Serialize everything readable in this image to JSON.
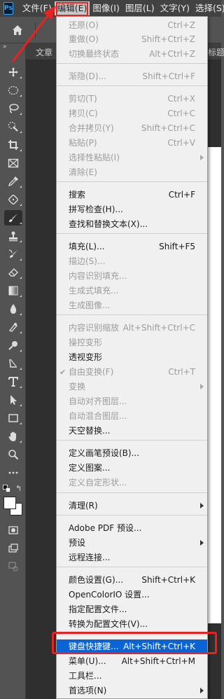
{
  "menubar": {
    "logo": "Ps",
    "items": [
      "文件(F)",
      "编辑(E)",
      "图像(I)",
      "图层(L)",
      "文字(Y)",
      "选择(S)"
    ],
    "active_index": 1
  },
  "doc_tabs": {
    "tab1": "文章",
    "tab2": "标题"
  },
  "edit_menu": {
    "items": [
      {
        "label": "还原(O)",
        "shortcut": "Ctrl+Z",
        "disabled": true
      },
      {
        "label": "重做(O)",
        "shortcut": "Shift+Ctrl+Z",
        "disabled": true
      },
      {
        "label": "切换最终状态",
        "shortcut": "Alt+Ctrl+Z",
        "disabled": true
      },
      {
        "label": "渐隐(D)...",
        "shortcut": "Shift+Ctrl+F",
        "disabled": true
      },
      {
        "label": "剪切(T)",
        "shortcut": "Ctrl+X",
        "disabled": true
      },
      {
        "label": "拷贝(C)",
        "shortcut": "Ctrl+C",
        "disabled": true
      },
      {
        "label": "合并拷贝(Y)",
        "shortcut": "Shift+Ctrl+C",
        "disabled": true
      },
      {
        "label": "粘贴(P)",
        "shortcut": "Ctrl+V",
        "disabled": true
      },
      {
        "label": "选择性粘贴(I)",
        "shortcut": "",
        "disabled": true,
        "submenu": true
      },
      {
        "label": "清除(E)",
        "shortcut": "",
        "disabled": true
      },
      {
        "label": "搜索",
        "shortcut": "Ctrl+F",
        "disabled": false
      },
      {
        "label": "拼写检查(H)...",
        "shortcut": "",
        "disabled": false
      },
      {
        "label": "查找和替换文本(X)...",
        "shortcut": "",
        "disabled": false
      },
      {
        "label": "填充(L)...",
        "shortcut": "Shift+F5",
        "disabled": false
      },
      {
        "label": "描边(S)...",
        "shortcut": "",
        "disabled": true
      },
      {
        "label": "内容识别填充...",
        "shortcut": "",
        "disabled": true
      },
      {
        "label": "生成式填充...",
        "shortcut": "",
        "disabled": true
      },
      {
        "label": "生成图像...",
        "shortcut": "",
        "disabled": true
      },
      {
        "label": "内容识别缩放",
        "shortcut": "Alt+Shift+Ctrl+C",
        "disabled": true
      },
      {
        "label": "操控变形",
        "shortcut": "",
        "disabled": true
      },
      {
        "label": "透视变形",
        "shortcut": "",
        "disabled": false
      },
      {
        "label": "自由变换(F)",
        "shortcut": "Ctrl+T",
        "disabled": true,
        "checked": true
      },
      {
        "label": "变换",
        "shortcut": "",
        "disabled": true,
        "submenu": true
      },
      {
        "label": "自动对齐图层...",
        "shortcut": "",
        "disabled": true
      },
      {
        "label": "自动混合图层...",
        "shortcut": "",
        "disabled": true
      },
      {
        "label": "天空替换...",
        "shortcut": "",
        "disabled": false
      },
      {
        "label": "定义画笔预设(B)...",
        "shortcut": "",
        "disabled": false
      },
      {
        "label": "定义图案...",
        "shortcut": "",
        "disabled": false
      },
      {
        "label": "定义自定形状...",
        "shortcut": "",
        "disabled": true
      },
      {
        "label": "清理(R)",
        "shortcut": "",
        "disabled": false,
        "submenu": true
      },
      {
        "label": "Adobe PDF 预设...",
        "shortcut": "",
        "disabled": false
      },
      {
        "label": "预设",
        "shortcut": "",
        "disabled": false,
        "submenu": true
      },
      {
        "label": "远程连接...",
        "shortcut": "",
        "disabled": false
      },
      {
        "label": "颜色设置(G)...",
        "shortcut": "Shift+Ctrl+K",
        "disabled": false
      },
      {
        "label": "OpenColorIO 设置...",
        "shortcut": "",
        "disabled": false
      },
      {
        "label": "指定配置文件...",
        "shortcut": "",
        "disabled": false
      },
      {
        "label": "转换为配置文件(V)...",
        "shortcut": "",
        "disabled": false
      },
      {
        "label": "键盘快捷键...",
        "shortcut": "Alt+Shift+Ctrl+K",
        "disabled": false,
        "highlighted": true
      },
      {
        "label": "菜单(U)...",
        "shortcut": "Alt+Shift+Ctrl+M",
        "disabled": false
      },
      {
        "label": "工具栏...",
        "shortcut": "",
        "disabled": false
      },
      {
        "label": "首选项(N)",
        "shortcut": "",
        "disabled": false,
        "submenu": true
      }
    ]
  },
  "toolbar": {
    "tools": [
      "move-tool",
      "marquee-tool",
      "lasso-tool",
      "quick-select-tool",
      "crop-tool",
      "frame-tool",
      "eyedropper-tool",
      "healing-tool",
      "brush-tool",
      "clone-stamp-tool",
      "history-brush-tool",
      "eraser-tool",
      "gradient-tool",
      "blur-tool",
      "smudge-tool",
      "dodge-tool",
      "pen-tool",
      "type-tool",
      "path-select-tool",
      "rectangle-tool",
      "hand-tool",
      "zoom-tool",
      "more-tools"
    ],
    "selected_tool": "brush-tool"
  },
  "colors": {
    "highlight": "#0a64d6",
    "annotation_red": "#e8231f"
  }
}
